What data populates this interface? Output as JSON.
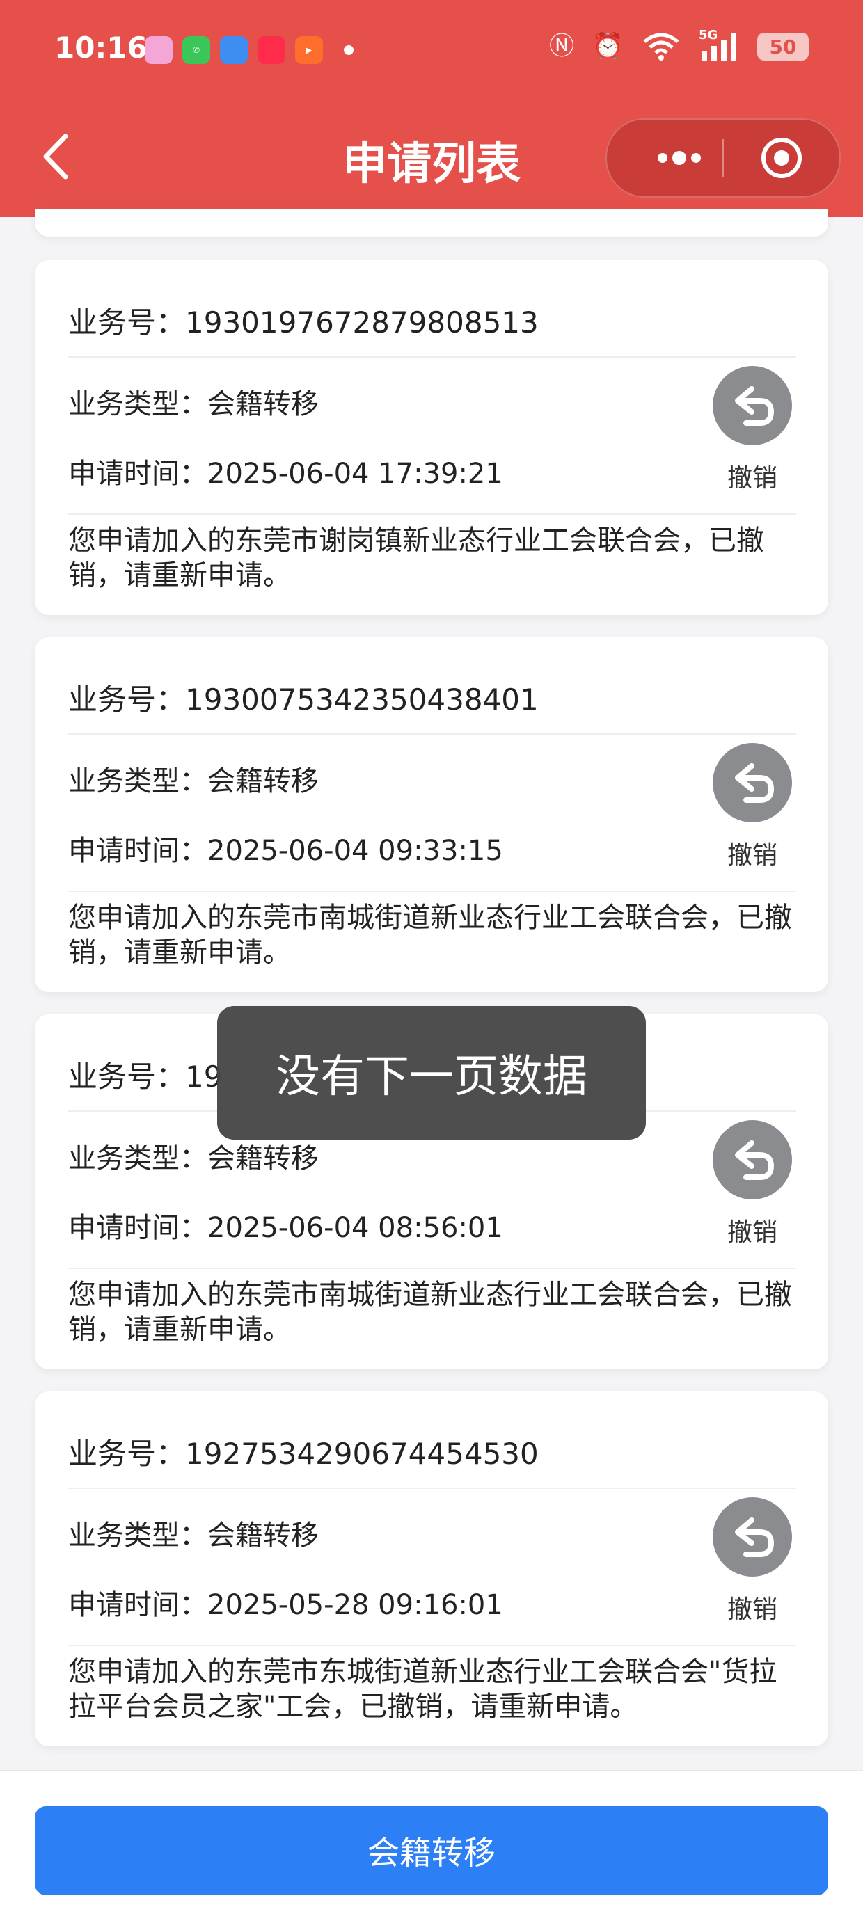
{
  "status_bar": {
    "time": "10:16",
    "battery": "50",
    "network": "5G"
  },
  "nav": {
    "title": "申请列表"
  },
  "labels": {
    "business_no": "业务号：",
    "business_type": "业务类型：",
    "apply_time": "申请时间："
  },
  "applications": [
    {
      "id": "1930197672879808513",
      "type": "会籍转移",
      "time": "2025-06-04 17:39:21",
      "action": "撤销",
      "description": "您申请加入的东莞市谢岗镇新业态行业工会联合会，已撤销，请重新申请。"
    },
    {
      "id": "1930075342350438401",
      "type": "会籍转移",
      "time": "2025-06-04 09:33:15",
      "action": "撤销",
      "description": "您申请加入的东莞市南城街道新业态行业工会联合会，已撤销，请重新申请。"
    },
    {
      "id": "19",
      "type": "会籍转移",
      "time": "2025-06-04 08:56:01",
      "action": "撤销",
      "description": "您申请加入的东莞市南城街道新业态行业工会联合会，已撤销，请重新申请。"
    },
    {
      "id": "1927534290674454530",
      "type": "会籍转移",
      "time": "2025-05-28 09:16:01",
      "action": "撤销",
      "description": "您申请加入的东莞市东城街道新业态行业工会联合会\"货拉拉平台会员之家\"工会，已撤销，请重新申请。"
    }
  ],
  "toast": {
    "message": "没有下一页数据"
  },
  "bottom": {
    "button_label": "会籍转移"
  },
  "colors": {
    "header": "#e5504b",
    "primary": "#2d7ff5",
    "revoke_icon": "#8b8c90"
  }
}
